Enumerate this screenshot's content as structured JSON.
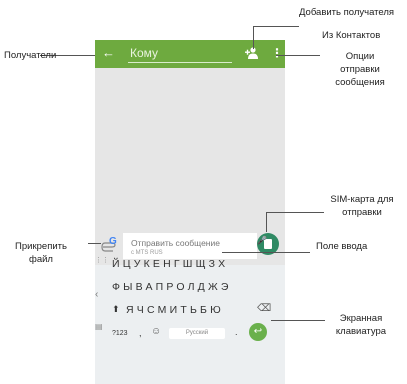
{
  "callouts": {
    "add_recipient": "Добавить получателя",
    "from_contacts": "Из Контактов",
    "recipients": "Получатели",
    "send_options_1": "Опции",
    "send_options_2": "отправки",
    "send_options_3": "сообщения",
    "sim_card_1": "SIM-карта для",
    "sim_card_2": "отправки",
    "attach_1": "Прикрепить",
    "attach_2": "файл",
    "input_field": "Поле ввода",
    "keyboard_1": "Экранная",
    "keyboard_2": "клавиатура"
  },
  "appbar": {
    "back_glyph": "←",
    "to_placeholder": "Кому",
    "menu_glyph": "⋮"
  },
  "composer": {
    "placeholder": "Отправить сообщение",
    "sim_label": "с MTS RUS"
  },
  "keyboard": {
    "google": "G",
    "mic": "🎤",
    "row1": "ЙЦУКЕНГШЩЗХ",
    "row2": "ФЫВАПРОЛДЖЭ",
    "row3": "ЯЧСМИТЬБЮ",
    "shift": "⬆",
    "backspace": "⌫",
    "numbers": "?123",
    "comma": ",",
    "emoji": "☺",
    "space": "Русский",
    "period": ".",
    "enter": "↩"
  },
  "colors": {
    "appbar": "#6eaa3f",
    "sim_button": "#2f8a64",
    "enter_button": "#6ab04c",
    "screen_bg": "#e6e6e6"
  }
}
